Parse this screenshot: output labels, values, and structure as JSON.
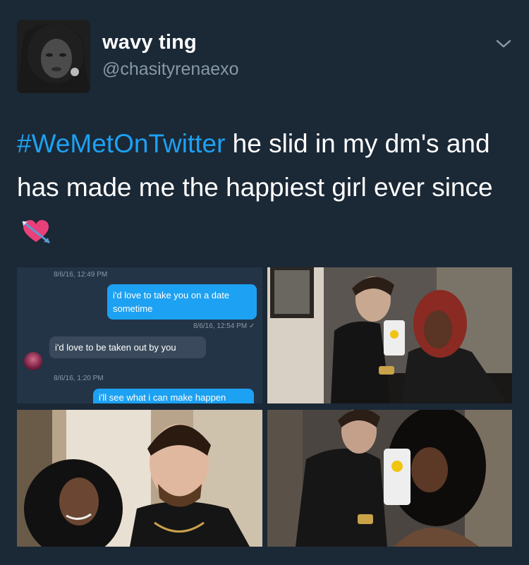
{
  "user": {
    "display_name": "wavy ting",
    "handle": "@chasityrenaexo"
  },
  "tweet": {
    "hashtag": "#WeMetOnTwitter",
    "text": " he slid in my dm's and has made me the happiest girl ever since",
    "emoji": "heart-with-arrow"
  },
  "dm": {
    "messages": [
      {
        "timestamp": "8/6/16, 12:49 PM"
      },
      {
        "text": "i'd love to take you on a date sometime",
        "direction": "out"
      },
      {
        "timestamp": "8/6/16, 12:54 PM ✓"
      },
      {
        "text": "i'd love to be taken out by you",
        "direction": "in"
      },
      {
        "timestamp": "8/6/16, 1:20 PM"
      },
      {
        "text": "i'll see what i can make happen",
        "direction": "out"
      }
    ]
  },
  "colors": {
    "background": "#1b2836",
    "hashtag": "#1da1f2",
    "muted": "#8899a6"
  }
}
